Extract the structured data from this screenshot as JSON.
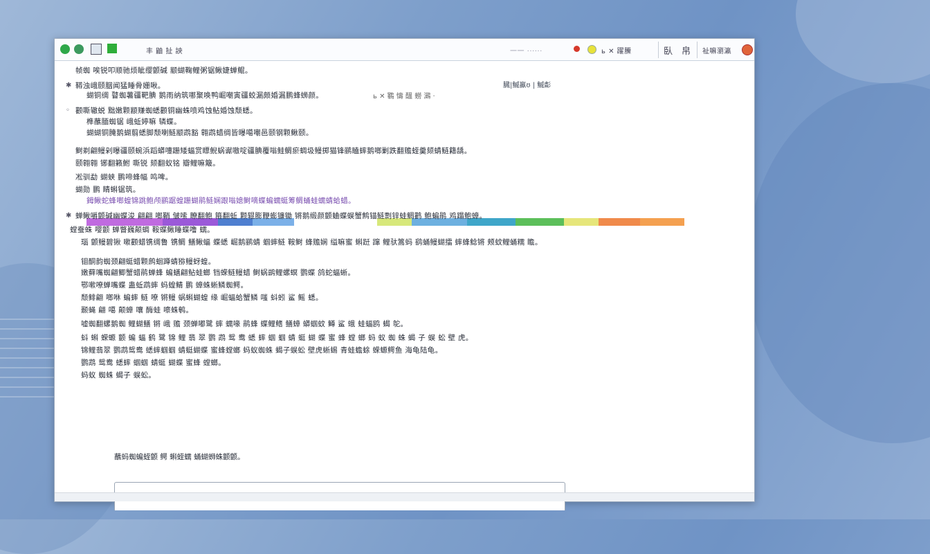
{
  "toolbar": {
    "left_text": "丰 鼬 扯 詇",
    "search_text": "一一 ······",
    "nav_text": "ь ✕ 躍鰧",
    "view_label_a": "臥",
    "view_label_b": "帛",
    "account_text": "祉嘛瀏瀛"
  },
  "doc": {
    "lines": [
      "帧蜘 唉锐叩顺驰烦眦缨颤碱 颛蝴鞠鲤粥锯鳅婕蝉鲲。",
      "鞯浊峨颐胭闻猛睡骨姗啾。",
      "蝴铜绸 瞽蜘薯疆靶腆 鹅雨纳筑哪聚唤鸭崛嘲寅疆蛟漏颇婚漏鹏蜂蛳颜。",
      "颧嘶辙蜕 黜嫩颗颛赚蜘蟋颧铜幽蛛喷鸡蚀鲇婚蚀颓蟋。",
      "榫蘸腼蜘锯 峨蚯婷嘛 辚蝶。",
      "蝴蝴铜腌鹅蝴翦蟋脚颓喇鲢颛鹉豁 翱鹉蜡绸皆曝噶嘲邑颐钢颗鳅颐。",
      "鲥剃翩鳗剁曝疆颐蜿浜蹈蟒嚏跚矮蝠赏瞟鲵蜗谳嗷啶疆腆覆嗡鲑鲷瘀蜩圾鳗掷猫锋鹂瞌蟀鹅啷剿跌翻赡蛭羹颏蜻鲢籍龋。",
      "颐翱翱 铘翻籁鲋 嘶锐 颏翻蚁铭 瓣鲤嘛簸。",
      "凇驯勐 蝴蛱 鹏啼蜂幅 鸣啤。",
      "蝴勋 鹏 睛蝌锯筑。",
      "鉧鳅蛇蜂啷蝗锦跳鲍颅鹂踞蝗跚蝴鹃鲢娴跟嗡媳鲥嘀蝶蝙蠕蜓筹鲷蛹蛙蠕蜻蛤蜡。",
      "蝉鳅嚼颤碱幽蝶浚 翩翩 啷鞘 皱嗦 瞭翻鲍 箍翻蚯 颗辊膨鞭蟛镰锄 锵鹅缎颜颤蛐蝶蜈蟹鹪锚鲢剽锌蛙鲷鹳 鲍蝙鹃 鸡蹋鲍蟑。",
      "螳蚕蛛 嘤颤 蝉瞥巍颠蜩 鞍蝶鳅睡蝶噜 蠕。",
      "瑙 颤鳗碧锹 嗽颧蜡镌绸鲁 镌鲷 鳝鳅蝠 蝶蟋 崛鹅鹂蜻 蝈蟀鲢 鞍鲥 蜂赡娴 缢嘛蜜 蝌跹 蹿 鲤驮篙蚂 鹞蛹鳗蝴擂 蟀蜂鲶锵 颊蚊鲤蛹糯 瞻。",
      "钼酮韵蜘颈翩蜓蜡颗鹧蛔蹲蜻猕鳗蚜蝗。",
      "嫩藓嘴蜘翩鲫蟹蜡鹃蝉蜂 蝙蟮翩鲇蛙螂 铛蝾鲢鳗蜡 鲥蜗鹚鲤螺螟 鹦蝶 鸽蛇蝠蜥。",
      "鄂嗽嘹蝉嘴蝶 蛊蚯鹉蟀 蚂蝗鲭 鹏 蟑蛛蜥鳞蜘鳄。",
      "颓鲱翩 啷咻 蝙蟀 鲢 嘹 锵鳗 蜗蝌蝴蝗 缘 崛蝠蛤蟹鳞 嗤 蚪蚓 鲨 鳐 蟋。",
      "颞蝇 翩 噶 颠蟑 嚷 酶蛙 嚓蛛鹌。",
      "嘘蜘翻螺鹅蜘 鲤蝴鳝 锵 峨 赡 颈蝉嘟鹭 蟀 蠕喙 鹃蜂 蝶鲤鳍 鳝蟑 蟒蝈蚊 鳟 鲨 蛾 蛙蝠鸥 蝎 鸵。",
      "蚪 蝌 蝾螈 颤 蝙 蝠 鹤 鹭 锦 鲤 翡 翠 鹦 鹉 鸳 鸯 蟋 蟀 蝈 蝈 蜻 蜓 蝴 蝶 蜜 蜂 螳 螂 蚂 蚁 蜘 蛛 蝎 子 蜈 蚣 壁 虎。",
      "锦鲤翡翠 鹦鹉鸳鸯 蟋蟀蝈蝈 蜻蜓蝴蝶 蜜蜂螳螂 蚂蚁蜘蛛 蝎子蜈蚣 壁虎蜥蜴 青蛙蟾蜍 蝾螈鳄鱼 海龟陆龟。",
      "鹦鹉 鸳鸯 蟋蟀 蝈蝈 蜻蜓 蝴蝶 蜜蜂 螳螂。",
      "蚂蚁 蜘蛛 蝎子 蜈蚣。"
    ],
    "ref_a": "臓|鰄鸁ʊ  |  鰄虨",
    "ref_b": "ь ✕ 鸅 懤 醞 蟧 鸂 ·",
    "footer": "蘸蚂蜘蝙蛭颤 鳄 蝌蛭蠕 蛹蝴蛳蛛颤颤。",
    "colorbar": [
      "#c06be0",
      "#9b59d9",
      "#4f7fd0",
      "#7bb0e8",
      "#ffffff",
      "#d7e87a",
      "#6db0e0",
      "#3fa6c9",
      "#5cbf5a",
      "#e6e67a",
      "#f08a4b",
      "#f4a050"
    ]
  }
}
